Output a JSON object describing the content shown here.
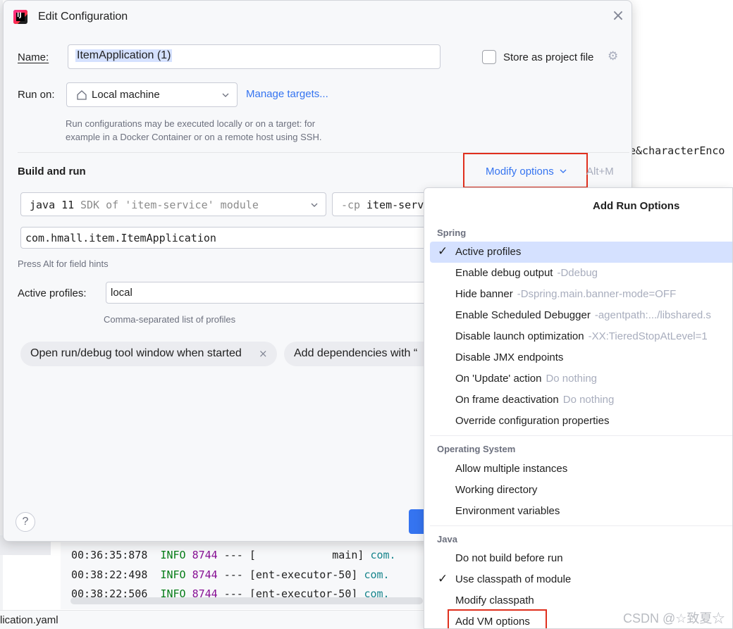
{
  "background": {
    "right_text": "e&characterEnco",
    "console_lines": [
      {
        "time": "00:36:35:878",
        "level": "INFO",
        "pid": "8744",
        "sep": "---",
        "thread": "[            main]",
        "cls": "com."
      },
      {
        "time": "00:38:22:498",
        "level": "INFO",
        "pid": "8744",
        "sep": "---",
        "thread": "[ent-executor-50]",
        "cls": "com."
      },
      {
        "time": "00:38:22:506",
        "level": "INFO",
        "pid": "8744",
        "sep": "---",
        "thread": "[ent-executor-50]",
        "cls": "com."
      }
    ],
    "status_file": "lication.yaml",
    "watermark": "CSDN @☆致夏☆"
  },
  "dialog": {
    "title": "Edit Configuration",
    "name_label": "Name:",
    "name_value": "ItemApplication (1)",
    "store_label": "Store as project file",
    "run_on_label": "Run on:",
    "run_on_value": "Local machine",
    "manage_targets": "Manage targets...",
    "run_on_hint_1": "Run configurations may be executed locally or on a target: for",
    "run_on_hint_2": "example in a Docker Container or on a remote host using SSH.",
    "section_title": "Build and run",
    "modify_options": "Modify options",
    "modify_shortcut": "Alt+M",
    "jdk_prefix": "java 11",
    "jdk_suffix": "SDK of 'item-service' module",
    "cp_prefix": "-cp",
    "cp_value": "item-serv",
    "main_class": "com.hmall.item.ItemApplication",
    "field_hint": "Press Alt for field hints",
    "profiles_label": "Active profiles:",
    "profiles_value": "local",
    "profiles_hint": "Comma-separated list of profiles",
    "chips": [
      {
        "label": "Open run/debug tool window when started",
        "closable": true
      },
      {
        "label": "Add dependencies with “",
        "closable": false
      }
    ],
    "help": "?"
  },
  "popup": {
    "title": "Add Run Options",
    "groups": [
      {
        "label": "Spring",
        "items": [
          {
            "label": "Active profiles",
            "hint": "",
            "checked": true,
            "selected": true
          },
          {
            "label": "Enable debug output",
            "hint": "-Ddebug",
            "checked": false,
            "selected": false
          },
          {
            "label": "Hide banner",
            "hint": "-Dspring.main.banner-mode=OFF",
            "checked": false,
            "selected": false
          },
          {
            "label": "Enable Scheduled Debugger",
            "hint": "-agentpath:.../libshared.s",
            "checked": false,
            "selected": false
          },
          {
            "label": "Disable launch optimization",
            "hint": "-XX:TieredStopAtLevel=1",
            "checked": false,
            "selected": false
          },
          {
            "label": "Disable JMX endpoints",
            "hint": "",
            "checked": false,
            "selected": false
          },
          {
            "label": "On 'Update' action",
            "hint": "Do nothing",
            "checked": false,
            "selected": false
          },
          {
            "label": "On frame deactivation",
            "hint": "Do nothing",
            "checked": false,
            "selected": false
          },
          {
            "label": "Override configuration properties",
            "hint": "",
            "checked": false,
            "selected": false
          }
        ]
      },
      {
        "label": "Operating System",
        "items": [
          {
            "label": "Allow multiple instances",
            "hint": "",
            "checked": false,
            "selected": false
          },
          {
            "label": "Working directory",
            "hint": "",
            "checked": false,
            "selected": false
          },
          {
            "label": "Environment variables",
            "hint": "",
            "checked": false,
            "selected": false
          }
        ]
      },
      {
        "label": "Java",
        "items": [
          {
            "label": "Do not build before run",
            "hint": "",
            "checked": false,
            "selected": false
          },
          {
            "label": "Use classpath of module",
            "hint": "",
            "checked": true,
            "selected": false
          },
          {
            "label": "Modify classpath",
            "hint": "",
            "checked": false,
            "selected": false
          },
          {
            "label": "Add VM options",
            "hint": "",
            "checked": false,
            "selected": false
          }
        ]
      }
    ]
  },
  "colors": {
    "accent": "#3574f0",
    "highlight_box": "#e0301e",
    "selection": "#d5e1ff"
  }
}
